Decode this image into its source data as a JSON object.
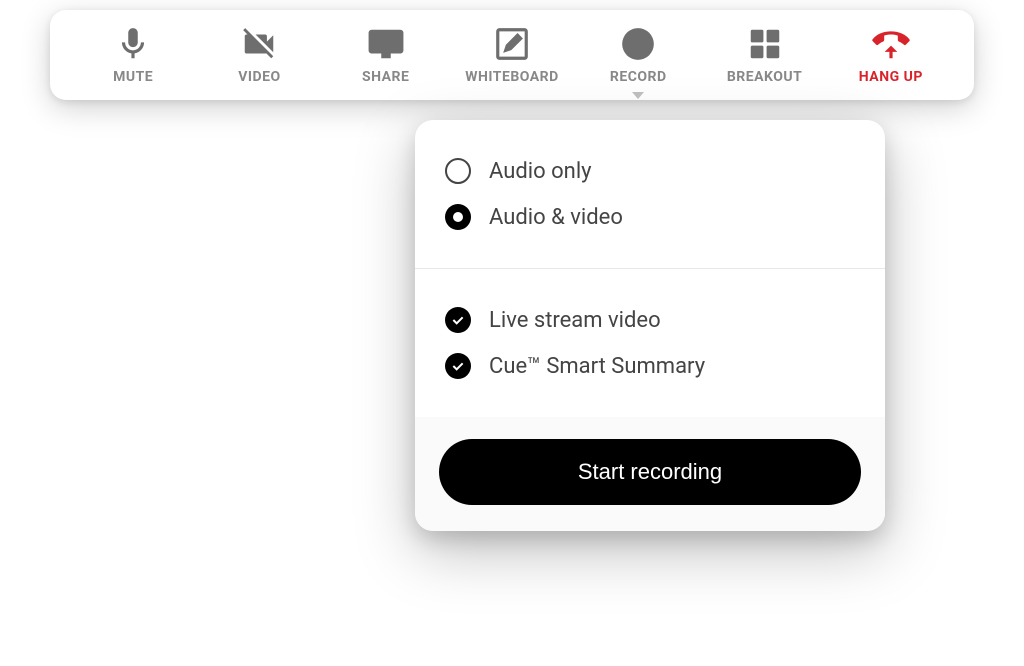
{
  "toolbar": {
    "mute": {
      "label": "MUTE"
    },
    "video": {
      "label": "VIDEO"
    },
    "share": {
      "label": "SHARE"
    },
    "whiteboard": {
      "label": "WHITEBOARD"
    },
    "record": {
      "label": "RECORD"
    },
    "breakout": {
      "label": "BREAKOUT"
    },
    "hangup": {
      "label": "HANG UP"
    }
  },
  "record_popup": {
    "options": {
      "audio_only": {
        "label": "Audio only",
        "selected": false
      },
      "audio_video": {
        "label": "Audio & video",
        "selected": true
      }
    },
    "features": {
      "live_stream": {
        "label": "Live stream video",
        "checked": true
      },
      "cue_summary": {
        "label": "Cue™ Smart Summary",
        "checked": true
      }
    },
    "start_button": "Start recording"
  }
}
